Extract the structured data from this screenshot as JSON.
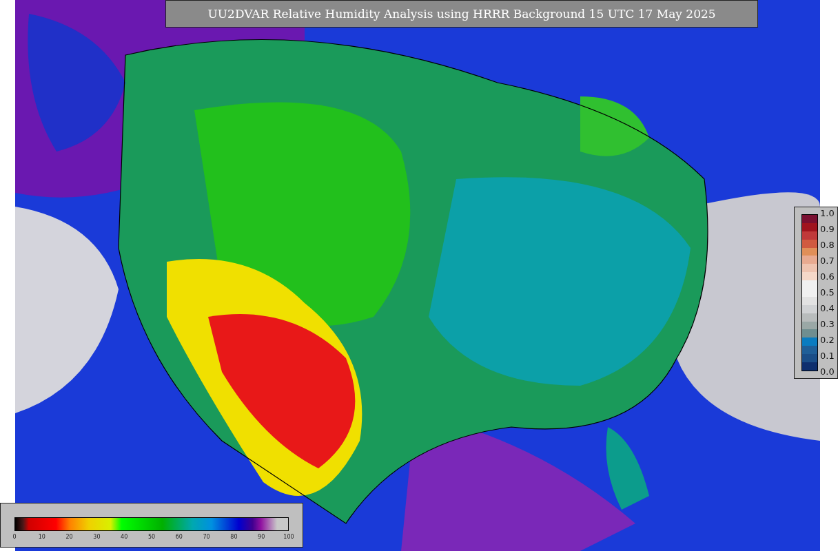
{
  "title": "UU2DVAR Relative Humidity Analysis using HRRR Background 15 UTC 17 May 2025",
  "humidity_colorbar": {
    "tick_labels": [
      "0",
      "10",
      "20",
      "30",
      "40",
      "50",
      "60",
      "70",
      "80",
      "90",
      "100"
    ]
  },
  "fraction_colorbar": {
    "tick_labels": [
      "1.0",
      "0.9",
      "0.8",
      "0.7",
      "0.6",
      "0.5",
      "0.4",
      "0.3",
      "0.2",
      "0.1",
      "0.0"
    ]
  }
}
